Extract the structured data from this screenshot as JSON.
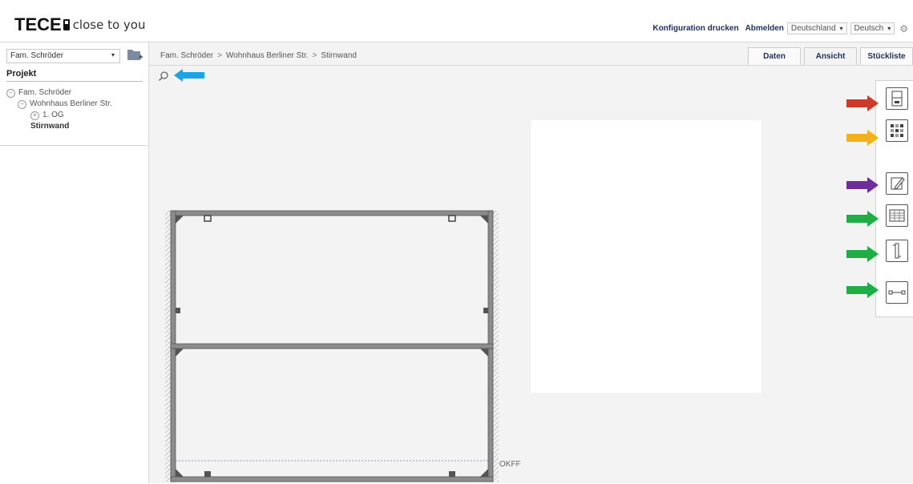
{
  "header": {
    "logo_brand": "TECE",
    "logo_tagline": "close to you",
    "print_link": "Konfiguration drucken",
    "logout_link": "Abmelden",
    "country": "Deutschland",
    "language": "Deutsch"
  },
  "sidebar": {
    "project_select": "Fam. Schröder",
    "section_title": "Projekt",
    "tree": [
      {
        "label": "Fam. Schröder",
        "toggle": "−"
      },
      {
        "label": "Wohnhaus Berliner Str.",
        "toggle": "−"
      },
      {
        "label": "1. OG",
        "toggle": "+"
      },
      {
        "label": "Stirnwand"
      }
    ]
  },
  "breadcrumb": [
    "Fam. Schröder",
    "Wohnhaus Berliner Str.",
    "Stirnwand"
  ],
  "breadcrumb_sep": ">",
  "tabs": [
    "Daten",
    "Ansicht",
    "Stückliste"
  ],
  "active_tab": "Ansicht",
  "canvas": {
    "floor_label": "OKFF"
  },
  "tools": [
    {
      "icon": "frame-element-icon",
      "arrow_color": "#cc3a2c"
    },
    {
      "icon": "grid-pattern-icon",
      "arrow_color": "#f2b21b"
    },
    {
      "icon": "edit-icon",
      "arrow_color": "#6e2e9a"
    },
    {
      "icon": "panel-rows-icon",
      "arrow_color": "#1fae45"
    },
    {
      "icon": "vertical-profile-icon",
      "arrow_color": "#1fae45"
    },
    {
      "icon": "connector-icon",
      "arrow_color": "#1fae45"
    }
  ],
  "zoom_arrow_color": "#1aa5e6"
}
